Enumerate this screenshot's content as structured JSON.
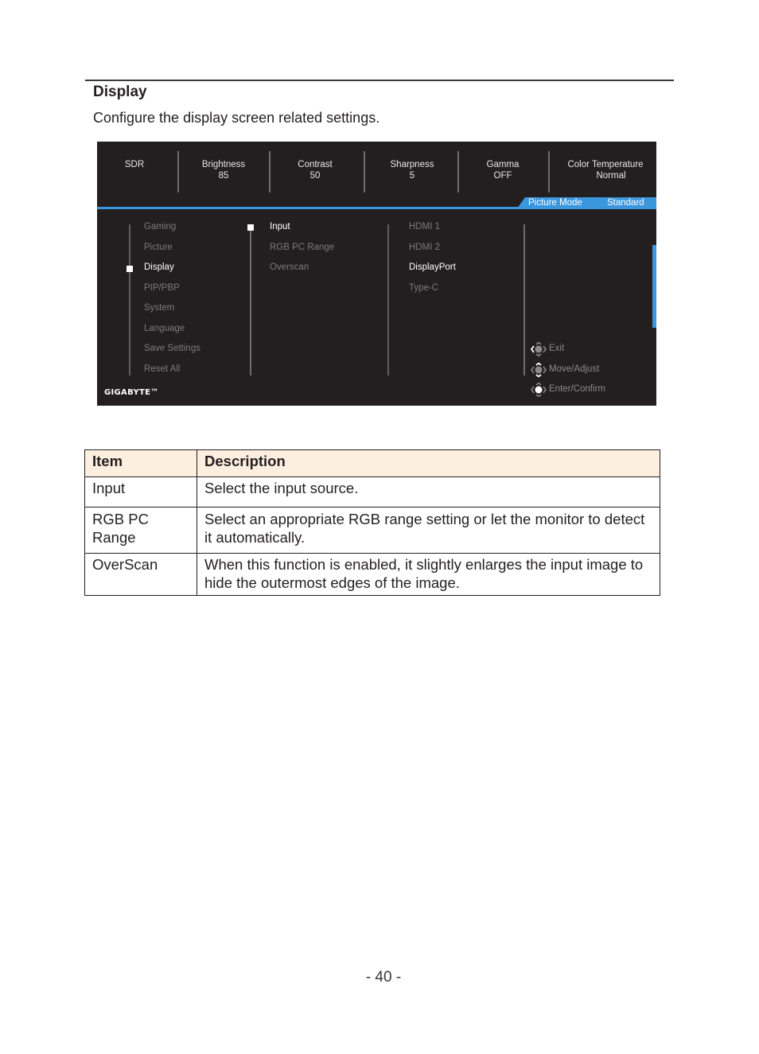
{
  "section": {
    "title": "Display",
    "description": "Configure the display screen related settings."
  },
  "osd": {
    "top_bar": [
      {
        "label": "SDR",
        "value": ""
      },
      {
        "label": "Brightness",
        "value": "85"
      },
      {
        "label": "Contrast",
        "value": "50"
      },
      {
        "label": "Sharpness",
        "value": "5"
      },
      {
        "label": "Gamma",
        "value": "OFF"
      },
      {
        "label": "Color Temperature",
        "value": "Normal"
      }
    ],
    "picture_mode": {
      "label": "Picture Mode",
      "value": "Standard"
    },
    "main_menu": [
      {
        "label": "Gaming",
        "active": false
      },
      {
        "label": "Picture",
        "active": false
      },
      {
        "label": "Display",
        "active": true
      },
      {
        "label": "PIP/PBP",
        "active": false
      },
      {
        "label": "System",
        "active": false
      },
      {
        "label": "Language",
        "active": false
      },
      {
        "label": "Save Settings",
        "active": false
      },
      {
        "label": "Reset All",
        "active": false
      }
    ],
    "sub_menu": [
      {
        "label": "Input",
        "active": true
      },
      {
        "label": "RGB PC Range",
        "active": false
      },
      {
        "label": "Overscan",
        "active": false
      }
    ],
    "options": [
      {
        "label": "HDMI 1",
        "active": false
      },
      {
        "label": "HDMI 2",
        "active": false
      },
      {
        "label": "DisplayPort",
        "active": true
      },
      {
        "label": "Type-C",
        "active": false
      }
    ],
    "hints": [
      {
        "icon": "joystick-left-icon",
        "label": "Exit"
      },
      {
        "icon": "joystick-move-icon",
        "label": "Move/Adjust"
      },
      {
        "icon": "joystick-press-icon",
        "label": "Enter/Confirm"
      }
    ],
    "brand": "GIGABYTE™",
    "accent_color": "#3b97dd"
  },
  "table": {
    "headers": [
      "Item",
      "Description"
    ],
    "rows": [
      {
        "item": "Input",
        "description": "Select the input source."
      },
      {
        "item": "RGB PC Range",
        "description": "Select an appropriate RGB range setting or let the monitor to detect it automatically."
      },
      {
        "item": "OverScan",
        "description": "When this function is enabled, it slightly enlarges the input image to hide the outermost edges of the image."
      }
    ]
  },
  "page_number": "- 40 -"
}
